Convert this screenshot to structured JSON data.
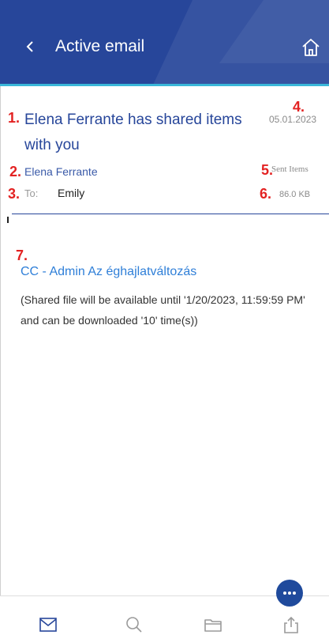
{
  "header": {
    "title": "Active email",
    "icons": [
      "back-arrow",
      "home"
    ]
  },
  "annotations": [
    "1.",
    "2.",
    "3.",
    "4.",
    "5.",
    "6.",
    "7."
  ],
  "email": {
    "subject": "Elena Ferrante has shared items with you",
    "date": "05.01.2023",
    "sender": "Elena Ferrante",
    "folder": "Sent Items",
    "to_label": "To:",
    "to_value": "Emily",
    "size": "86.0 KB"
  },
  "attachment": {
    "title": "CC - Admin Az éghajlatváltozás"
  },
  "body": {
    "text": "(Shared file will be available until '1/20/2023, 11:59:59 PM' and can be downloaded '10' time(s))"
  },
  "bottom_nav": {
    "items": [
      "mail-icon",
      "search-icon",
      "folder-icon",
      "share-icon"
    ]
  },
  "colors": {
    "header": "#27469a",
    "accent_line": "#3ab7d9",
    "subject": "#27469a",
    "attachment": "#2f7fd8",
    "annotation": "#e32222"
  }
}
